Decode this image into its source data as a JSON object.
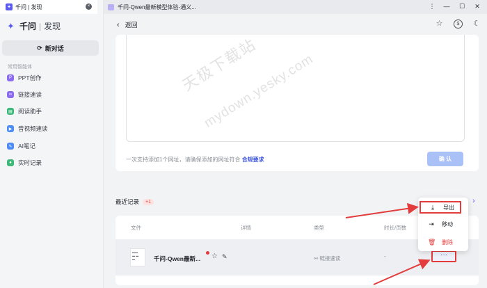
{
  "sidebar": {
    "tab_title": "千问 | 发现",
    "brand_name": "千问",
    "brand_sep": "|",
    "brand_sub": "发现",
    "new_chat": "新对话",
    "section_label": "常用智能体",
    "items": [
      {
        "label": "PPT创作",
        "icon": "ppt-icon",
        "color": "#8b6cf0"
      },
      {
        "label": "链接速读",
        "icon": "link-icon",
        "color": "#8b6cf0"
      },
      {
        "label": "阅读助手",
        "icon": "reading-icon",
        "color": "#3cb878"
      },
      {
        "label": "音视频速读",
        "icon": "media-icon",
        "color": "#4d8cf5"
      },
      {
        "label": "AI笔记",
        "icon": "note-icon",
        "color": "#4d8cf5"
      },
      {
        "label": "实时记录",
        "icon": "record-icon",
        "color": "#3cb878"
      }
    ]
  },
  "topbar": {
    "tab_title": "千问-Qwen最新模型体验-通义..."
  },
  "header": {
    "back_label": "返回"
  },
  "input_card": {
    "hint": "一次支持添加1个网址，请确保添加的网址符合",
    "hint_link": "合规要求",
    "confirm": "确 认"
  },
  "recent": {
    "title": "最近记录",
    "count": "+1",
    "columns": [
      "文件",
      "详情",
      "类型",
      "时长/页数"
    ],
    "rows": [
      {
        "name": "千问-Qwen最新...",
        "type": "链接速读",
        "duration": "-",
        "more": "···"
      }
    ]
  },
  "menu": {
    "items": [
      {
        "label": "导出",
        "icon": "download-icon"
      },
      {
        "label": "移动",
        "icon": "move-icon"
      },
      {
        "label": "删除",
        "icon": "trash-icon"
      }
    ]
  },
  "watermark": {
    "line1": "天极下载站",
    "line2": "mydown.yesky.com"
  },
  "colors": {
    "accent": "#5b5bf0",
    "danger": "#e23c3c",
    "link": "#3f57e0"
  }
}
